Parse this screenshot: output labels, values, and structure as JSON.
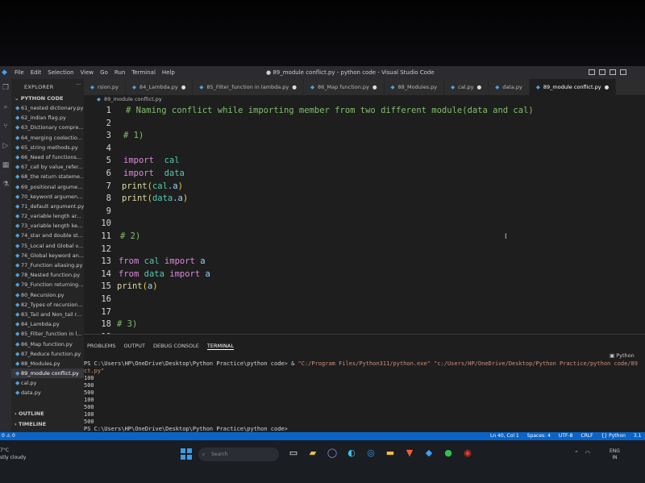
{
  "window": {
    "title": "● 89_module conflict.py - python code - Visual Studio Code",
    "menu": [
      "File",
      "Edit",
      "Selection",
      "View",
      "Go",
      "Run",
      "Terminal",
      "Help"
    ]
  },
  "sidebar": {
    "header": "EXPLORER",
    "dots": "···",
    "section": "PYTHON CODE",
    "items": [
      "61_nested dictionary.py",
      "62_indian flag.py",
      "63_Dictionary compre...",
      "64_merging coolectio...",
      "65_string methods.py",
      "66_Need of functions...",
      "67_call by value_refer...",
      "68_the return stateme...",
      "69_positional argume...",
      "70_keyword argumen...",
      "71_default argument.py",
      "72_variable length ar...",
      "73_variable length ke...",
      "74_star and double st...",
      "75_Local and Global v...",
      "76_Global keyword an...",
      "77_Function aliasing.py",
      "78_Nested function.py",
      "79_Function returning...",
      "80_Recursion.py",
      "82_Types of recursion...",
      "83_Tail and Non_tail r...",
      "84_Lambda.py",
      "85_Filter_function in l...",
      "86_Map function.py",
      "87_Reduce function.py",
      "88_Modules.py",
      "89_module conflict.py",
      "cal.py",
      "data.py"
    ],
    "outline": "OUTLINE",
    "timeline": "TIMELINE"
  },
  "tabs": [
    {
      "label": "rsion.py",
      "modified": false
    },
    {
      "label": "84_Lambda.py",
      "modified": true
    },
    {
      "label": "85_Filter_function in lambda.py",
      "modified": true
    },
    {
      "label": "86_Map function.py",
      "modified": true
    },
    {
      "label": "88_Modules.py",
      "modified": false
    },
    {
      "label": "cal.py",
      "modified": true
    },
    {
      "label": "data.py",
      "modified": false
    },
    {
      "label": "89_module conflict.py",
      "modified": true,
      "active": true
    }
  ],
  "breadcrumb": "89_module conflict.py",
  "editor": {
    "lines": [
      {
        "n": "1",
        "indent": "",
        "tokens": [
          [
            "c-comment",
            "# Naming conflict while importing member from two different module(data and cal)"
          ]
        ]
      },
      {
        "n": "2",
        "indent": "",
        "tokens": []
      },
      {
        "n": "3",
        "indent": "",
        "tokens": [
          [
            "c-comment",
            "# 1)"
          ]
        ]
      },
      {
        "n": "4",
        "indent": "",
        "tokens": []
      },
      {
        "n": "5",
        "indent": "",
        "tokens": [
          [
            "c-kw",
            "import"
          ],
          [
            "",
            "  "
          ],
          [
            "c-mod",
            "cal"
          ]
        ]
      },
      {
        "n": "6",
        "indent": "",
        "tokens": [
          [
            "c-kw",
            "import"
          ],
          [
            "",
            "  "
          ],
          [
            "c-mod",
            "data"
          ]
        ]
      },
      {
        "n": "7",
        "indent": "",
        "tokens": [
          [
            "c-fn",
            "print"
          ],
          [
            "c-paren",
            "("
          ],
          [
            "c-mod",
            "cal"
          ],
          [
            "",
            ""
          ],
          [
            "c-var",
            ".a"
          ],
          [
            "c-paren",
            ")"
          ]
        ]
      },
      {
        "n": "8",
        "indent": "",
        "tokens": [
          [
            "c-fn",
            "print"
          ],
          [
            "c-paren",
            "("
          ],
          [
            "c-mod",
            "data"
          ],
          [
            "c-var",
            ".a"
          ],
          [
            "c-paren",
            ")"
          ]
        ]
      },
      {
        "n": "9",
        "indent": "",
        "tokens": []
      },
      {
        "n": "10",
        "indent": "",
        "tokens": []
      },
      {
        "n": "11",
        "indent": "",
        "tokens": [
          [
            "c-comment",
            "# 2)"
          ]
        ]
      },
      {
        "n": "12",
        "indent": "",
        "tokens": []
      },
      {
        "n": "13",
        "indent": "",
        "tokens": [
          [
            "c-kw",
            "from"
          ],
          [
            "",
            " "
          ],
          [
            "c-mod",
            "cal"
          ],
          [
            "",
            " "
          ],
          [
            "c-kw",
            "import"
          ],
          [
            "",
            " "
          ],
          [
            "c-var",
            "a"
          ]
        ]
      },
      {
        "n": "14",
        "indent": "",
        "tokens": [
          [
            "c-kw",
            "from"
          ],
          [
            "",
            " "
          ],
          [
            "c-mod",
            "data"
          ],
          [
            "",
            " "
          ],
          [
            "c-kw",
            "import"
          ],
          [
            "",
            " "
          ],
          [
            "c-var",
            "a"
          ]
        ]
      },
      {
        "n": "15",
        "indent": "",
        "tokens": [
          [
            "c-fn",
            "print"
          ],
          [
            "c-paren",
            "("
          ],
          [
            "c-var",
            "a"
          ],
          [
            "c-paren",
            ")"
          ]
        ]
      },
      {
        "n": "16",
        "indent": "",
        "tokens": []
      },
      {
        "n": "17",
        "indent": "",
        "tokens": []
      },
      {
        "n": "18",
        "indent": "",
        "tokens": [
          [
            "c-comment",
            "# 3)"
          ]
        ]
      },
      {
        "n": "19",
        "indent": "",
        "tokens": []
      }
    ]
  },
  "panel": {
    "tabs": [
      "PROBLEMS",
      "OUTPUT",
      "DEBUG CONSOLE",
      "TERMINAL"
    ],
    "terminal_name": "Python",
    "prompt1": "PS C:\\Users\\HP\\OneDrive\\Desktop\\Python Practice\\python code> ",
    "amp": "& ",
    "cmd_exe": "\"C:/Program Files/Python311/python.exe\"",
    "cmd_path": " \"c:/Users/HP/OneDrive/Desktop/Python Practice/python code/89",
    "cmd_cont": "ct.py\"",
    "output": [
      "100",
      "500",
      "500",
      "100",
      "500",
      "100",
      "500"
    ],
    "prompt2": "PS C:\\Users\\HP\\OneDrive\\Desktop\\Python Practice\\python code>"
  },
  "statusbar": {
    "left": "0 ⚠ 0",
    "position": "Ln 40, Col 1",
    "spaces": "Spaces: 4",
    "encoding": "UTF-8",
    "eol": "CRLF",
    "language": "{} Python",
    "version": "3.1"
  },
  "taskbar": {
    "weather_temp": "7°C",
    "weather_desc": "stly cloudy",
    "search_placeholder": "Search",
    "lang1": "ENG",
    "lang2": "IN"
  }
}
